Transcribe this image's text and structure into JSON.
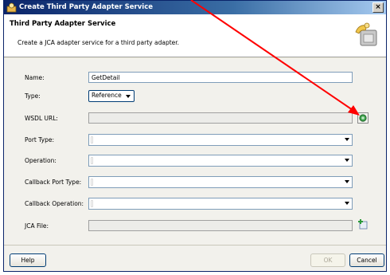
{
  "window": {
    "title": "Create Third Party Adapter Service",
    "close_label": "×"
  },
  "header": {
    "title": "Third Party Adapter Service",
    "description": "Create a JCA adapter service for a third party adapter."
  },
  "form": {
    "name": {
      "label": "Name:",
      "value": "GetDetail"
    },
    "type": {
      "label": "Type:",
      "value": "Reference"
    },
    "wsdl_url": {
      "label": "WSDL URL:",
      "value": ""
    },
    "port_type": {
      "label": "Port Type:"
    },
    "operation": {
      "label": "Operation:"
    },
    "callback_port_type": {
      "label": "Callback Port Type:"
    },
    "callback_operation": {
      "label": "Callback Operation:"
    },
    "jca_file": {
      "label": "JCA File:",
      "value": ""
    }
  },
  "footer": {
    "help_label": "Help",
    "ok_label": "OK",
    "cancel_label": "Cancel"
  },
  "colors": {
    "annotation_arrow": "#ff0000",
    "title_bar": "#0a246a"
  }
}
